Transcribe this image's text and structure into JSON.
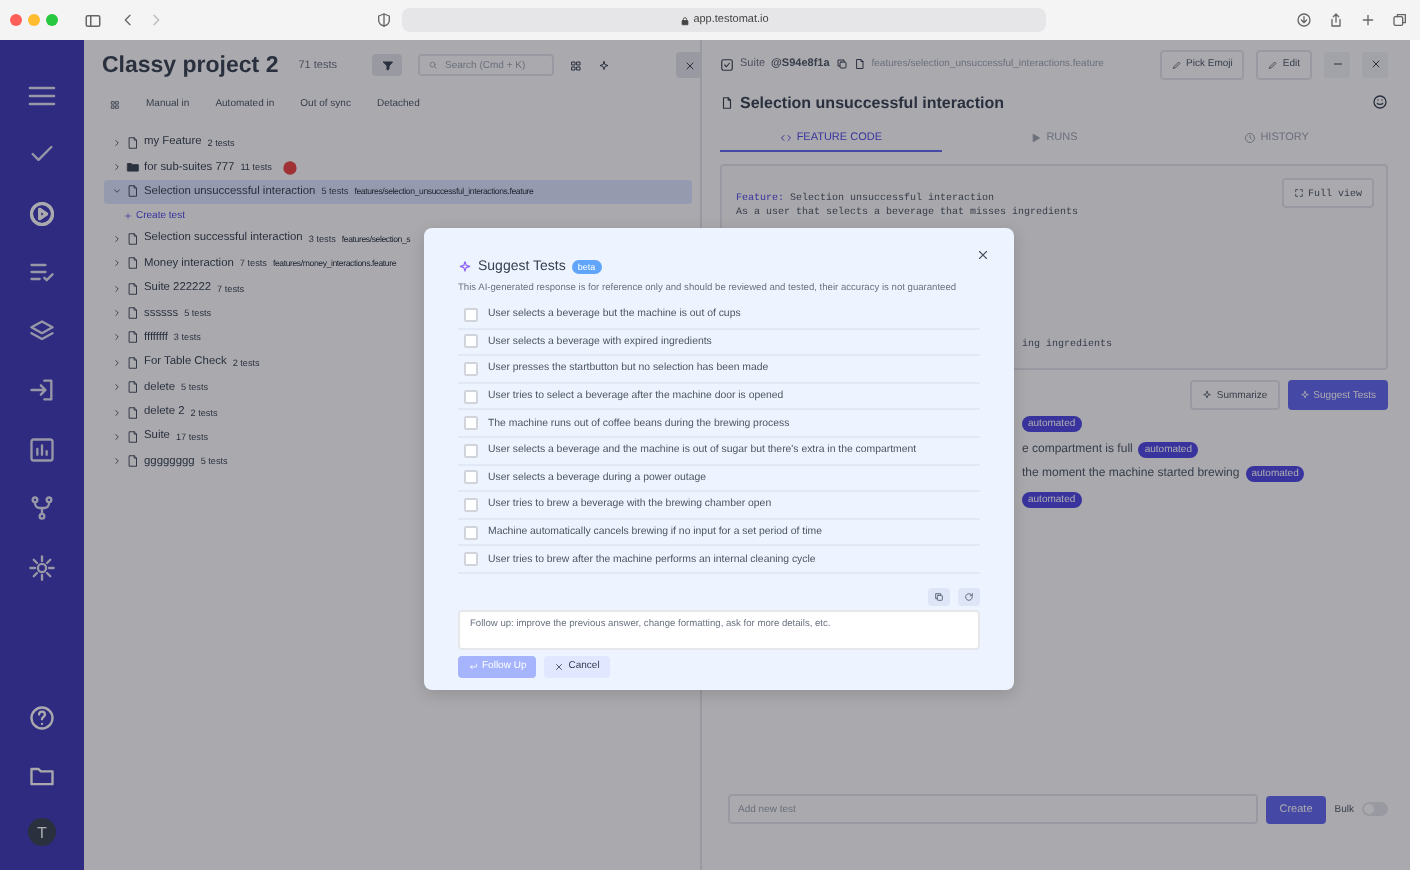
{
  "browser": {
    "url": "app.testomat.io"
  },
  "sidebar": {
    "items": [
      {
        "kind": "menu",
        "selected": false
      },
      {
        "kind": "check",
        "selected": false
      },
      {
        "kind": "play",
        "selected": true
      },
      {
        "kind": "list",
        "selected": false
      },
      {
        "kind": "layers",
        "selected": false
      },
      {
        "kind": "import",
        "selected": false
      },
      {
        "kind": "chart",
        "selected": false
      },
      {
        "kind": "branch",
        "selected": false
      },
      {
        "kind": "gear",
        "selected": false
      }
    ],
    "bottom": [
      {
        "kind": "help"
      },
      {
        "kind": "folder"
      }
    ],
    "avatar": "T"
  },
  "project": {
    "title": "Classy project 2",
    "count": "71 tests",
    "search_placeholder": "Search (Cmd + K)"
  },
  "filters": [
    "Manual in",
    "Automated in",
    "Out of sync",
    "Detached"
  ],
  "tree": [
    {
      "kind": "file",
      "name": "my Feature",
      "count": "2 tests",
      "expanded": false,
      "selected": false,
      "flagged": false
    },
    {
      "kind": "folder",
      "name": "for sub-suites 777",
      "count": "11 tests",
      "expanded": false,
      "selected": false,
      "flagged": true
    },
    {
      "kind": "file",
      "name": "Selection unsuccessful interaction",
      "count": "5 tests",
      "path": "features/selection_unsuccessful_interactions.feature",
      "expanded": true,
      "selected": true,
      "flagged": false,
      "children": [
        {
          "kind": "create",
          "name": "Create test"
        }
      ]
    },
    {
      "kind": "file",
      "name": "Selection successful interaction",
      "count": "3 tests",
      "path": "features/selection_s",
      "expanded": false,
      "selected": false,
      "flagged": false
    },
    {
      "kind": "file",
      "name": "Money interaction",
      "count": "7 tests",
      "path": "features/money_interactions.feature",
      "expanded": false,
      "selected": false,
      "flagged": false
    },
    {
      "kind": "file",
      "name": "Suite 222222",
      "count": "7 tests",
      "expanded": false,
      "selected": false,
      "flagged": false
    },
    {
      "kind": "file",
      "name": "ssssss",
      "count": "5 tests",
      "expanded": false,
      "selected": false,
      "flagged": false
    },
    {
      "kind": "file",
      "name": "ffffffff",
      "count": "3 tests",
      "expanded": false,
      "selected": false,
      "flagged": false
    },
    {
      "kind": "file",
      "name": "For Table Check",
      "count": "2 tests",
      "expanded": false,
      "selected": false,
      "flagged": false
    },
    {
      "kind": "file",
      "name": "delete",
      "count": "5 tests",
      "expanded": false,
      "selected": false,
      "flagged": false
    },
    {
      "kind": "file",
      "name": "delete 2",
      "count": "2 tests",
      "expanded": false,
      "selected": false,
      "flagged": false
    },
    {
      "kind": "file",
      "name": "Suite",
      "count": "17 tests",
      "expanded": false,
      "selected": false,
      "flagged": false
    },
    {
      "kind": "file",
      "name": "gggggggg",
      "count": "5 tests",
      "expanded": false,
      "selected": false,
      "flagged": false
    }
  ],
  "suite": {
    "label": "Suite",
    "id": "@S94e8f1a",
    "path": "features/selection_unsuccessful_interactions.feature",
    "buttons": [
      "Pick Emoji",
      "Edit"
    ],
    "title": "Selection unsuccessful interaction",
    "tabs": [
      {
        "label": "FEATURE CODE",
        "selected": true
      },
      {
        "label": "RUNS",
        "selected": false
      },
      {
        "label": "HISTORY",
        "selected": false
      }
    ],
    "full_view": "Full view",
    "code": [
      {
        "kind": "line",
        "keyword": "Feature:",
        "text": "Selection unsuccessful interaction"
      },
      {
        "kind": "line",
        "text": "As a user that selects a beverage that misses ingredients"
      },
      {
        "kind": "fragment",
        "text": "ing ingredients"
      }
    ],
    "actions": [
      "Summarize",
      "Suggest Tests"
    ],
    "tests": [
      {
        "badge": "automated"
      },
      {
        "text": "e compartment is full",
        "badge": "automated"
      },
      {
        "text": "the moment the machine started brewing",
        "badge": "automated"
      },
      {
        "badge": "automated"
      }
    ]
  },
  "new_test": {
    "placeholder": "Add new test",
    "button": "Create",
    "bulk_label": "Bulk",
    "bulk_on": false
  },
  "modal": {
    "title": "Suggest Tests",
    "badge": "beta",
    "disclaimer": "This AI-generated response is for reference only and should be reviewed and tested, their accuracy is not guaranteed",
    "suggestions": [
      {
        "text": "User selects a beverage but the machine is out of cups",
        "checked": false
      },
      {
        "text": "User selects a beverage with expired ingredients",
        "checked": false
      },
      {
        "text": "User presses the startbutton but no selection has been made",
        "checked": false
      },
      {
        "text": "User tries to select a beverage after the machine door is opened",
        "checked": false
      },
      {
        "text": "The machine runs out of coffee beans during the brewing process",
        "checked": false
      },
      {
        "text": "User selects a beverage and the machine is out of sugar but there's extra in the compartment",
        "checked": false
      },
      {
        "text": "User selects a beverage during a power outage",
        "checked": false
      },
      {
        "text": "User tries to brew a beverage with the brewing chamber open",
        "checked": false
      },
      {
        "text": "Machine automatically cancels brewing if no input for a set period of time",
        "checked": false
      },
      {
        "text": "User tries to brew after the machine performs an internal cleaning cycle",
        "checked": false
      }
    ],
    "followup_placeholder": "Follow up: improve the previous answer, change formatting, ask for more details, etc.",
    "follow_up": {
      "label": "Follow Up",
      "disabled": true
    },
    "cancel": "Cancel"
  }
}
